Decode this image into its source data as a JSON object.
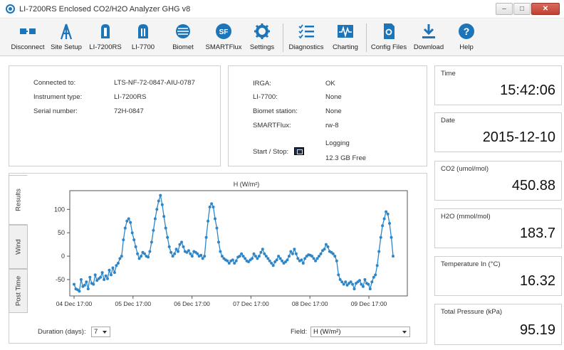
{
  "window": {
    "title": "LI-7200RS Enclosed CO2/H2O Analyzer GHG v8"
  },
  "toolbar": [
    {
      "label": "Disconnect",
      "icon": "disconnect-icon"
    },
    {
      "label": "Site Setup",
      "icon": "tower-icon"
    },
    {
      "label": "LI-7200RS",
      "icon": "analyzer-7200-icon"
    },
    {
      "label": "LI-7700",
      "icon": "analyzer-7700-icon"
    },
    {
      "label": "Biomet",
      "icon": "biomet-icon"
    },
    {
      "label": "SMARTFlux",
      "icon": "smartflux-icon"
    },
    {
      "label": "Settings",
      "icon": "gear-icon"
    },
    {
      "label": "Diagnostics",
      "icon": "checklist-icon"
    },
    {
      "label": "Charting",
      "icon": "waveform-icon"
    },
    {
      "label": "Config Files",
      "icon": "config-file-icon"
    },
    {
      "label": "Download",
      "icon": "download-icon"
    },
    {
      "label": "Help",
      "icon": "help-icon"
    }
  ],
  "connection": {
    "connected_to_label": "Connected to:",
    "connected_to": "LTS-NF-72-0847-AIU-0787",
    "instrument_type_label": "Instrument type:",
    "instrument_type": "LI-7200RS",
    "serial_number_label": "Serial number:",
    "serial_number": "72H-0847"
  },
  "status": {
    "irga_label": "IRGA:",
    "irga": "OK",
    "li7700_label": "LI-7700:",
    "li7700": "None",
    "biomet_label": "Biomet station:",
    "biomet": "None",
    "smartflux_label": "SMARTFlux:",
    "smartflux": "rw-8",
    "startstop_label": "Start / Stop:",
    "logging": "Logging",
    "free_space": "12.3 GB Free"
  },
  "readouts": [
    {
      "label": "Time",
      "value": "15:42:06"
    },
    {
      "label": "Date",
      "value": "2015-12-10"
    },
    {
      "label": "CO2 (umol/mol)",
      "value": "450.88"
    },
    {
      "label": "H2O (mmol/mol)",
      "value": "183.7"
    },
    {
      "label": "Temperature In (°C)",
      "value": "16.32"
    },
    {
      "label": "Total Pressure (kPa)",
      "value": "95.19"
    }
  ],
  "tabs": [
    "Results",
    "Wind",
    "Post Time"
  ],
  "chart_controls": {
    "duration_label": "Duration (days):",
    "duration_value": "7",
    "field_label": "Field:",
    "field_value": "H (W/m²)"
  },
  "chart_data": {
    "type": "line",
    "title": "H (W/m²)",
    "xlabel": "",
    "ylabel": "",
    "x_ticks": [
      "04 Dec 17:00",
      "05 Dec 17:00",
      "06 Dec 17:00",
      "07 Dec 17:00",
      "08 Dec 17:00",
      "09 Dec 17:00"
    ],
    "y_ticks": [
      100,
      50,
      0,
      -50
    ],
    "ylim": [
      -85,
      140
    ],
    "grid": false,
    "legend": "none",
    "color": "#2e86c8",
    "series": [
      {
        "values": [
          -60,
          -70,
          -72,
          -75,
          -50,
          -65,
          -62,
          -55,
          -70,
          -45,
          -58,
          -60,
          -40,
          -52,
          -48,
          -45,
          -35,
          -50,
          -42,
          -48,
          -30,
          -40,
          -25,
          -35,
          -20,
          -15,
          -5,
          0,
          35,
          60,
          75,
          80,
          72,
          50,
          35,
          20,
          5,
          -5,
          0,
          8,
          5,
          0,
          -2,
          10,
          30,
          55,
          80,
          100,
          118,
          130,
          110,
          85,
          60,
          40,
          20,
          8,
          0,
          5,
          15,
          10,
          25,
          30,
          20,
          10,
          8,
          12,
          5,
          0,
          10,
          8,
          5,
          0,
          2,
          -5,
          0,
          40,
          75,
          105,
          112,
          105,
          80,
          60,
          30,
          10,
          0,
          -5,
          -8,
          -10,
          -15,
          -10,
          -8,
          -15,
          -10,
          -2,
          0,
          5,
          0,
          -5,
          -10,
          -12,
          -8,
          -5,
          5,
          0,
          -5,
          0,
          8,
          15,
          5,
          0,
          -5,
          -10,
          -15,
          -20,
          -12,
          -8,
          0,
          -5,
          -10,
          -15,
          -12,
          -8,
          0,
          10,
          5,
          15,
          5,
          -5,
          -10,
          -8,
          -15,
          -5,
          0,
          3,
          2,
          0,
          -5,
          -10,
          -5,
          0,
          5,
          12,
          15,
          25,
          20,
          10,
          8,
          5,
          0,
          -10,
          -40,
          -50,
          -55,
          -60,
          -55,
          -62,
          -58,
          -55,
          -60,
          -70,
          -58,
          -55,
          -52,
          -60,
          -65,
          -50,
          -58,
          -60,
          -70,
          -55,
          -45,
          -40,
          -20,
          10,
          40,
          65,
          80,
          95,
          90,
          70,
          40,
          0
        ]
      }
    ]
  }
}
